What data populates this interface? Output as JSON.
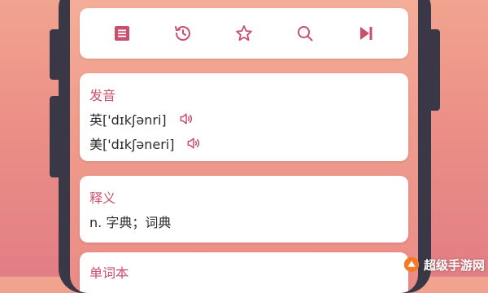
{
  "toolbar": {
    "icons": [
      "list-icon",
      "history-icon",
      "star-icon",
      "search-icon",
      "skip-next-icon"
    ],
    "accent": "#c94f6d"
  },
  "pronunciation": {
    "title": "发音",
    "uk": "英['dɪkʃənri]",
    "us": "美['dɪkʃəneri]"
  },
  "definition": {
    "title": "释义",
    "text": "n. 字典；词典"
  },
  "vocabulary": {
    "title": "单词本"
  },
  "watermark": {
    "text": "超级手游网"
  }
}
